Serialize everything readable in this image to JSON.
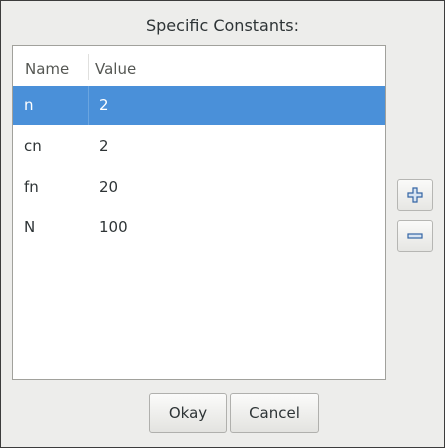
{
  "dialog": {
    "title": "Specific Constants:"
  },
  "table": {
    "columns": [
      "Name",
      "Value"
    ],
    "rows": [
      {
        "name": "n",
        "value": "2",
        "selected": true
      },
      {
        "name": "cn",
        "value": "2",
        "selected": false
      },
      {
        "name": "fn",
        "value": "20",
        "selected": false
      },
      {
        "name": "N",
        "value": "100",
        "selected": false
      }
    ]
  },
  "side_buttons": {
    "add_icon": "plus-icon",
    "remove_icon": "minus-icon"
  },
  "footer": {
    "okay_label": "Okay",
    "cancel_label": "Cancel"
  },
  "colors": {
    "selection": "#4a90d9",
    "icon_blue": "#3465a4"
  }
}
